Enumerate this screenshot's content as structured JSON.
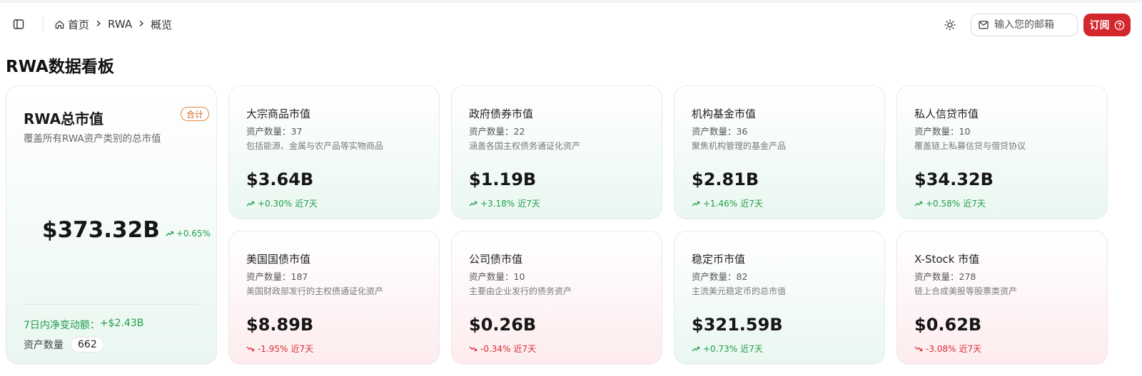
{
  "header": {
    "breadcrumb": [
      "首页",
      "RWA",
      "概览"
    ],
    "email_placeholder": "输入您的邮箱",
    "subscribe_label": "订阅",
    "accent": "#d3272e"
  },
  "page_title": "RWA数据看板",
  "total": {
    "title": "RWA总市值",
    "badge": "合计",
    "subtitle": "覆盖所有RWA资产类别的总市值",
    "value": "$373.32B",
    "change": "+0.65%",
    "net_label": "7日内净变动额：",
    "net_value": "+$2.43B",
    "count_label": "资产数量",
    "count_value": "662"
  },
  "cards": [
    {
      "title": "大宗商品市值",
      "count": "资产数量：37",
      "desc": "包括能源、金属与农产品等实物商品",
      "value": "$3.64B",
      "change": "+0.30%",
      "period": "近7天",
      "trend": "up"
    },
    {
      "title": "政府债券市值",
      "count": "资产数量：22",
      "desc": "涵盖各国主权债务通证化资产",
      "value": "$1.19B",
      "change": "+3.18%",
      "period": "近7天",
      "trend": "up"
    },
    {
      "title": "机构基金市值",
      "count": "资产数量：36",
      "desc": "聚焦机构管理的基金产品",
      "value": "$2.81B",
      "change": "+1.46%",
      "period": "近7天",
      "trend": "up"
    },
    {
      "title": "私人信贷市值",
      "count": "资产数量：10",
      "desc": "覆盖链上私募信贷与借贷协议",
      "value": "$34.32B",
      "change": "+0.58%",
      "period": "近7天",
      "trend": "up"
    },
    {
      "title": "美国国债市值",
      "count": "资产数量：187",
      "desc": "美国财政部发行的主权债通证化资产",
      "value": "$8.89B",
      "change": "-1.95%",
      "period": "近7天",
      "trend": "down"
    },
    {
      "title": "公司债市值",
      "count": "资产数量：10",
      "desc": "主要由企业发行的债务资产",
      "value": "$0.26B",
      "change": "-0.34%",
      "period": "近7天",
      "trend": "down"
    },
    {
      "title": "稳定币市值",
      "count": "资产数量：82",
      "desc": "主流美元稳定币的总市值",
      "value": "$321.59B",
      "change": "+0.73%",
      "period": "近7天",
      "trend": "up"
    },
    {
      "title": "X-Stock 市值",
      "count": "资产数量：278",
      "desc": "链上合成美股等股票类资产",
      "value": "$0.62B",
      "change": "-3.08%",
      "period": "近7天",
      "trend": "down"
    }
  ]
}
